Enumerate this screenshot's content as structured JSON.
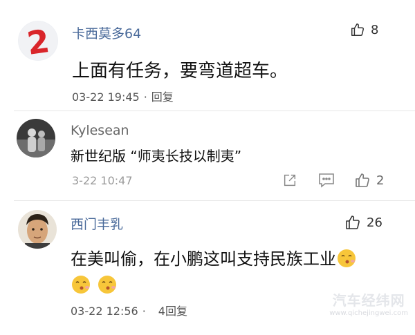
{
  "comments": [
    {
      "username": "卡西莫多64",
      "likes": "8",
      "content": "上面有任务，要弯道超车。",
      "date": "03-22 19:45",
      "reply_label": "回复"
    },
    {
      "username": "Kylesean",
      "content": "新世纪版 “师夷长技以制夷”",
      "date": "3-22 10:47",
      "likes": "2"
    },
    {
      "username": "西门丰乳",
      "likes": "26",
      "content": "在美叫偷，在小鹏这叫支持民族工业",
      "date": "03-22 12:56",
      "reply_label": "4回复"
    }
  ],
  "watermark": {
    "main": "汽车经纬网",
    "sub": "www.qichejingwei.com"
  },
  "colors": {
    "username": "#4a6a9a",
    "meta": "#555555",
    "emoji": "#f7c63a"
  }
}
